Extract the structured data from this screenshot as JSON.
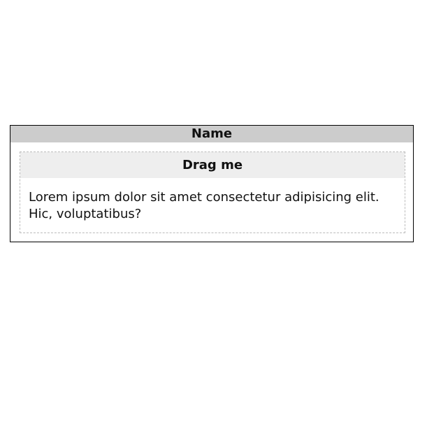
{
  "panel": {
    "title": "Name"
  },
  "card": {
    "handle_label": "Drag me",
    "body_text": "Lorem ipsum dolor sit amet consectetur adipisicing elit. Hic, voluptatibus?"
  }
}
